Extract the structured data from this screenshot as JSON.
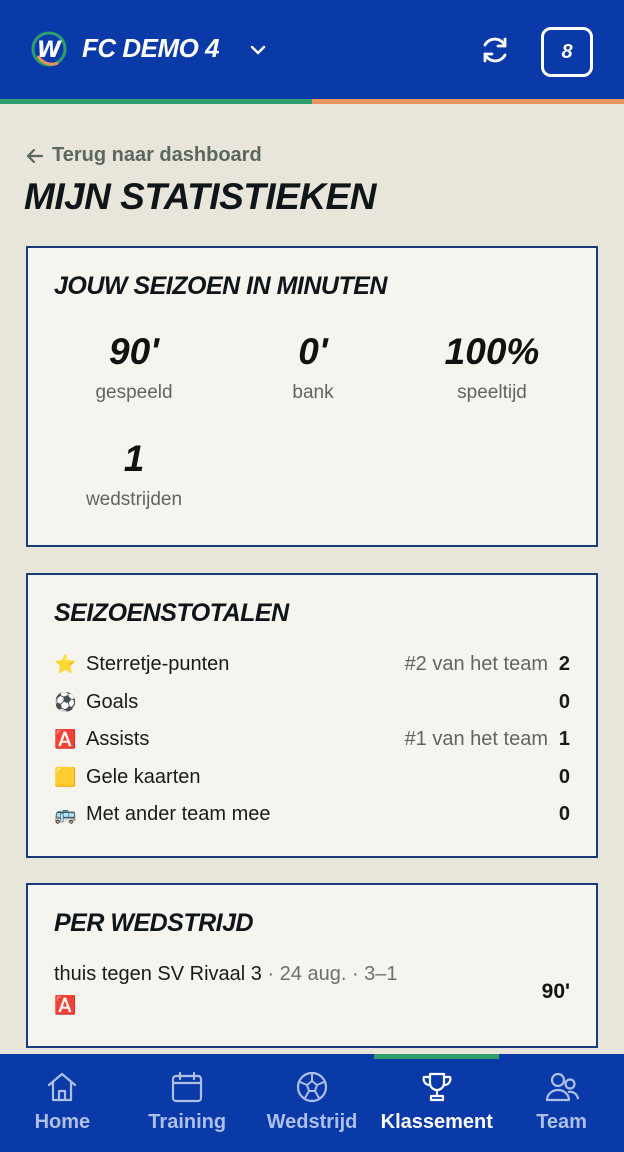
{
  "header": {
    "team_name": "FC DEMO 4",
    "badge_count": "8",
    "colors": {
      "bg": "#0a3aa8",
      "stripe_left": "#2e9f6b",
      "stripe_right": "#e8955c"
    }
  },
  "page": {
    "back_label": "Terug naar dashboard",
    "title": "MIJN STATISTIEKEN"
  },
  "minutes": {
    "title": "JOUW SEIZOEN IN MINUTEN",
    "stats": [
      {
        "value": "90'",
        "label": "gespeeld"
      },
      {
        "value": "0'",
        "label": "bank"
      },
      {
        "value": "100%",
        "label": "speeltijd"
      },
      {
        "value": "1",
        "label": "wedstrijden"
      }
    ]
  },
  "totals": {
    "title": "SEIZOENSTOTALEN",
    "rows": [
      {
        "emoji": "⭐",
        "label": "Sterretje-punten",
        "rank": "#2 van het team",
        "value": "2"
      },
      {
        "emoji": "⚽",
        "label": "Goals",
        "rank": "",
        "value": "0"
      },
      {
        "emoji": "🅰️",
        "label": "Assists",
        "rank": "#1 van het team",
        "value": "1"
      },
      {
        "emoji": "🟨",
        "label": "Gele kaarten",
        "rank": "",
        "value": "0"
      },
      {
        "emoji": "🚌",
        "label": "Met ander team mee",
        "rank": "",
        "value": "0"
      }
    ]
  },
  "per_match": {
    "title": "PER WEDSTRIJD",
    "matches": [
      {
        "opponent": "thuis tegen SV Rivaal 3",
        "meta": " · 24 aug. · 3–1",
        "icon": "🅰️",
        "minutes": "90'"
      }
    ]
  },
  "nav": {
    "items": [
      {
        "label": "Home",
        "icon": "home-icon"
      },
      {
        "label": "Training",
        "icon": "calendar-icon"
      },
      {
        "label": "Wedstrijd",
        "icon": "ball-icon"
      },
      {
        "label": "Klassement",
        "icon": "trophy-icon",
        "active": true
      },
      {
        "label": "Team",
        "icon": "people-icon"
      }
    ]
  }
}
